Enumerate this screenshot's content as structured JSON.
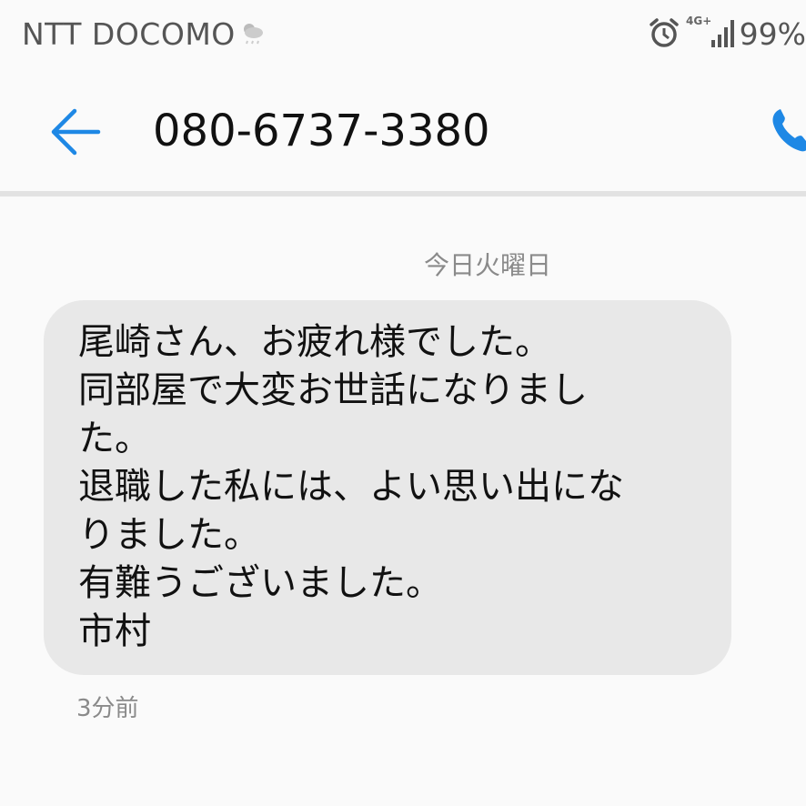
{
  "status_bar": {
    "carrier": "NTT DOCOMO",
    "network_type": "4G+",
    "battery": "99%",
    "icons": [
      "weather-icon",
      "alarm-icon",
      "signal-icon"
    ]
  },
  "header": {
    "title": "080-6737-3380",
    "back_icon": "arrow-left",
    "call_icon": "phone",
    "accent_color": "#1e88e5"
  },
  "conversation": {
    "date_label": "今日火曜日",
    "messages": [
      {
        "lines": [
          "尾崎さん、お疲れ様でした。",
          "同部屋で大変お世話になりまし",
          "た。",
          "退職した私には、よい思い出にな",
          "りました。",
          "有難うございました。",
          "市村"
        ],
        "time": "3分前"
      }
    ]
  },
  "colors": {
    "bubble_bg": "#e8e8e8",
    "background": "#fafafa",
    "secondary_text": "#8a8a8a"
  }
}
